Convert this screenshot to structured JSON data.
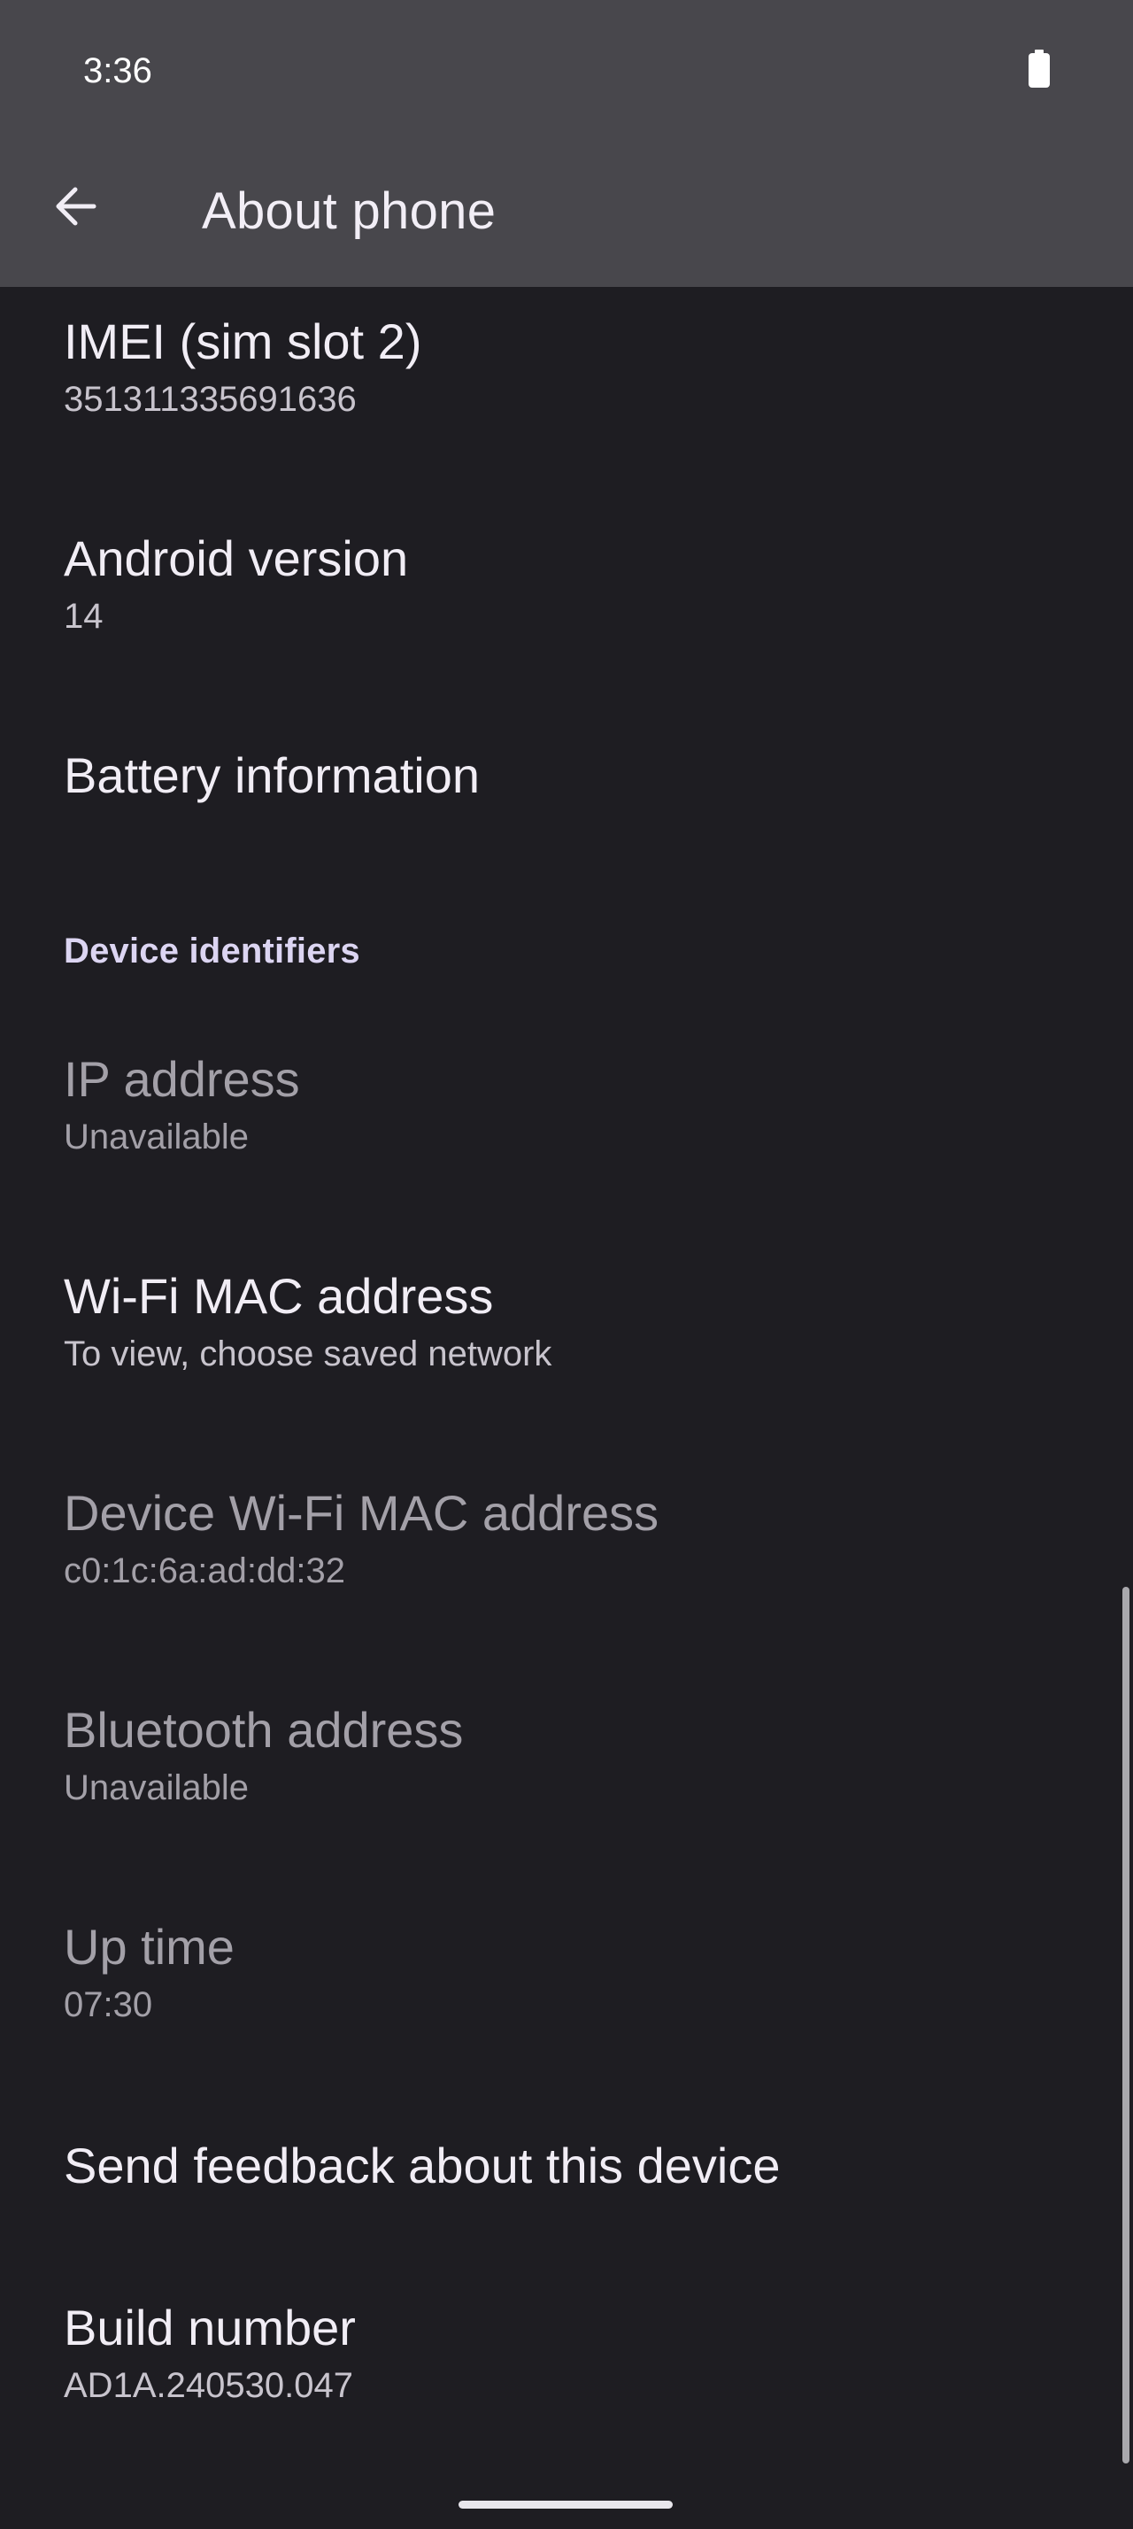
{
  "status_bar": {
    "time": "3:36",
    "battery_icon": "battery-icon"
  },
  "app_bar": {
    "back_icon": "arrow-back-icon",
    "title": "About phone"
  },
  "items": [
    {
      "title": "IMEI (sim slot 2)",
      "summary": "351311335691636",
      "enabled": true
    },
    {
      "title": "Android version",
      "summary": "14",
      "enabled": true
    },
    {
      "title": "Battery information",
      "summary": "",
      "enabled": true
    },
    {
      "title": "IP address",
      "summary": "Unavailable",
      "enabled": false
    },
    {
      "title": "Wi-Fi MAC address",
      "summary": "To view, choose saved network",
      "enabled": true
    },
    {
      "title": "Device Wi-Fi MAC address",
      "summary": "c0:1c:6a:ad:dd:32",
      "enabled": false
    },
    {
      "title": "Bluetooth address",
      "summary": "Unavailable",
      "enabled": false
    },
    {
      "title": "Up time",
      "summary": "07:30",
      "enabled": false
    },
    {
      "title": "Send feedback about this device",
      "summary": "",
      "enabled": true
    },
    {
      "title": "Build number",
      "summary": "AD1A.240530.047",
      "enabled": true
    }
  ],
  "section_header": "Device identifiers",
  "colors": {
    "app_bar_bg": "#48474c",
    "screen_bg": "#1e1d22",
    "title_text": "#f1edf5",
    "summary_text": "#c8c4cd",
    "disabled_text": "#a3a0a8",
    "section_header": "#dcd5f2"
  }
}
